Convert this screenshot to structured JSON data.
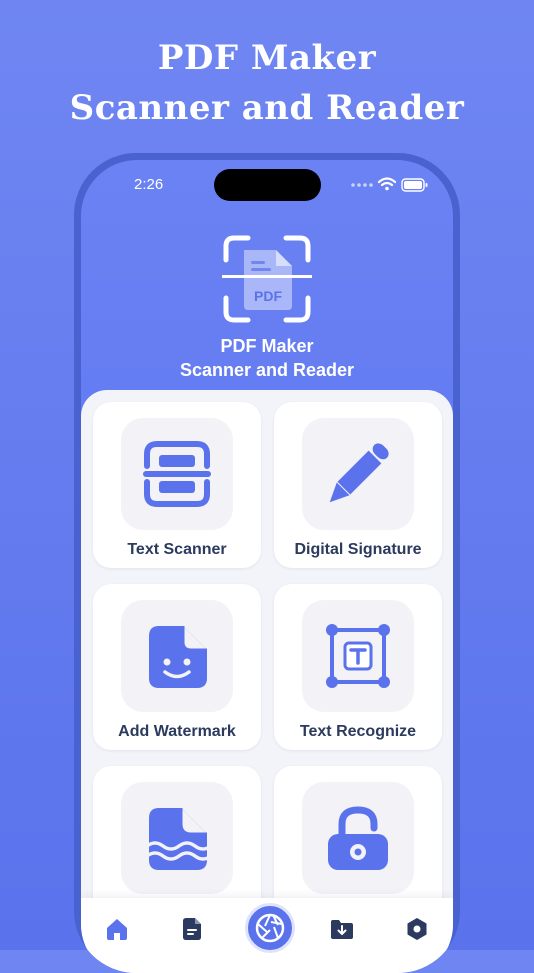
{
  "headline": {
    "line1": "PDF Maker",
    "line2": "Scanner and Reader"
  },
  "status_bar": {
    "time": "2:26"
  },
  "app": {
    "title_line1": "PDF Maker",
    "title_line2": "Scanner and Reader",
    "logo_text": "PDF"
  },
  "features": [
    {
      "label": "Text Scanner",
      "icon": "text-scanner-icon"
    },
    {
      "label": "Digital Signature",
      "icon": "pen-icon"
    },
    {
      "label": "Add Watermark",
      "icon": "watermark-doc-icon"
    },
    {
      "label": "Text Recognize",
      "icon": "text-recognize-icon"
    },
    {
      "label": "",
      "icon": "wave-doc-icon"
    },
    {
      "label": "",
      "icon": "lock-icon"
    }
  ],
  "tabbar": {
    "tabs": [
      {
        "icon": "home-icon",
        "active": true
      },
      {
        "icon": "document-icon"
      },
      {
        "icon": "camera-shutter-icon"
      },
      {
        "icon": "folder-download-icon"
      },
      {
        "icon": "settings-icon"
      }
    ]
  },
  "colors": {
    "accent": "#5a72ec",
    "label": "#2b3a5e",
    "tile": "#f2f2f7"
  }
}
